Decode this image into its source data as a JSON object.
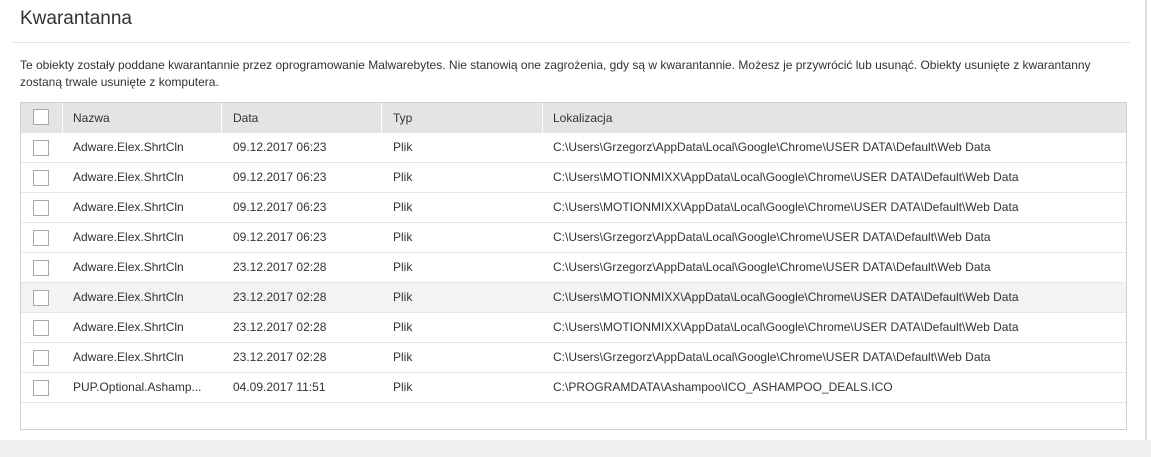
{
  "page": {
    "title": "Kwarantanna",
    "description": "Te obiekty zostały poddane kwarantannie przez oprogramowanie Malwarebytes. Nie stanowią one zagrożenia, gdy są w kwarantannie. Możesz je przywrócić lub usunąć. Obiekty usunięte z kwarantanny zostaną trwale usunięte z komputera."
  },
  "table": {
    "columns": {
      "name": "Nazwa",
      "date": "Data",
      "type": "Typ",
      "location": "Lokalizacja"
    },
    "rows": [
      {
        "name": "Adware.Elex.ShrtCln",
        "date": "09.12.2017 06:23",
        "type": "Plik",
        "location": "C:\\Users\\Grzegorz\\AppData\\Local\\Google\\Chrome\\USER DATA\\Default\\Web Data"
      },
      {
        "name": "Adware.Elex.ShrtCln",
        "date": "09.12.2017 06:23",
        "type": "Plik",
        "location": "C:\\Users\\MOTIONMIXX\\AppData\\Local\\Google\\Chrome\\USER DATA\\Default\\Web Data"
      },
      {
        "name": "Adware.Elex.ShrtCln",
        "date": "09.12.2017 06:23",
        "type": "Plik",
        "location": "C:\\Users\\MOTIONMIXX\\AppData\\Local\\Google\\Chrome\\USER DATA\\Default\\Web Data"
      },
      {
        "name": "Adware.Elex.ShrtCln",
        "date": "09.12.2017 06:23",
        "type": "Plik",
        "location": "C:\\Users\\Grzegorz\\AppData\\Local\\Google\\Chrome\\USER DATA\\Default\\Web Data"
      },
      {
        "name": "Adware.Elex.ShrtCln",
        "date": "23.12.2017 02:28",
        "type": "Plik",
        "location": "C:\\Users\\Grzegorz\\AppData\\Local\\Google\\Chrome\\USER DATA\\Default\\Web Data"
      },
      {
        "name": "Adware.Elex.ShrtCln",
        "date": "23.12.2017 02:28",
        "type": "Plik",
        "location": "C:\\Users\\MOTIONMIXX\\AppData\\Local\\Google\\Chrome\\USER DATA\\Default\\Web Data"
      },
      {
        "name": "Adware.Elex.ShrtCln",
        "date": "23.12.2017 02:28",
        "type": "Plik",
        "location": "C:\\Users\\MOTIONMIXX\\AppData\\Local\\Google\\Chrome\\USER DATA\\Default\\Web Data"
      },
      {
        "name": "Adware.Elex.ShrtCln",
        "date": "23.12.2017 02:28",
        "type": "Plik",
        "location": "C:\\Users\\Grzegorz\\AppData\\Local\\Google\\Chrome\\USER DATA\\Default\\Web Data"
      },
      {
        "name": "PUP.Optional.Ashamp...",
        "date": "04.09.2017 11:51",
        "type": "Plik",
        "location": "C:\\PROGRAMDATA\\Ashampoo\\ICO_ASHAMPOO_DEALS.ICO"
      }
    ]
  },
  "colors": {
    "header_bg": "#e4e4e4",
    "hover_row_bg": "#f3f3f3",
    "border": "#cfcfcf"
  }
}
